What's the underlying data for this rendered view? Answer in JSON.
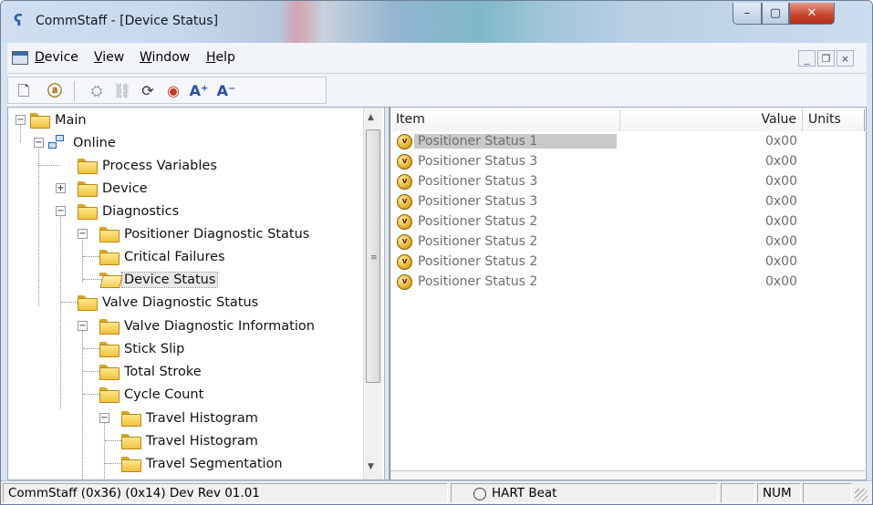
{
  "window": {
    "title": "CommStaff - [Device Status]",
    "controls": {
      "minimize": "–",
      "maximize": "▢",
      "close": "✕"
    }
  },
  "menubar": {
    "items": [
      "Device",
      "View",
      "Window",
      "Help"
    ],
    "mdi_controls": {
      "minimize": "_",
      "restore": "❐",
      "close": "×"
    }
  },
  "toolbar": {
    "icons": [
      "new-document-icon",
      "help-icon",
      "device-read-icon",
      "network-icon",
      "refresh-icon",
      "status-icon",
      "font-increase-icon",
      "font-decrease-icon"
    ]
  },
  "tree": {
    "items": [
      {
        "label": "Main",
        "level": 0,
        "expander": "minus",
        "icon": "folder"
      },
      {
        "label": "Online",
        "level": 1,
        "expander": "minus",
        "icon": "network"
      },
      {
        "label": "Process Variables",
        "level": 2,
        "expander": "",
        "icon": "folder"
      },
      {
        "label": "Device",
        "level": 2,
        "expander": "plus",
        "icon": "folder"
      },
      {
        "label": "Diagnostics",
        "level": 2,
        "expander": "minus",
        "icon": "folder"
      },
      {
        "label": "Positioner Diagnostic Status",
        "level": 3,
        "expander": "minus",
        "icon": "folder"
      },
      {
        "label": "Critical Failures",
        "level": 4,
        "expander": "",
        "icon": "folder"
      },
      {
        "label": "Device Status",
        "level": 4,
        "expander": "",
        "icon": "folder-open",
        "selected": true
      },
      {
        "label": "Valve Diagnostic Status",
        "level": 3,
        "expander": "",
        "icon": "folder"
      },
      {
        "label": "Valve Diagnostic Information",
        "level": 3,
        "expander": "minus",
        "icon": "folder"
      },
      {
        "label": "Stick Slip",
        "level": 4,
        "expander": "",
        "icon": "folder"
      },
      {
        "label": "Total Stroke",
        "level": 4,
        "expander": "",
        "icon": "folder"
      },
      {
        "label": "Cycle Count",
        "level": 4,
        "expander": "",
        "icon": "folder"
      },
      {
        "label": "Travel Histogram",
        "level": 4,
        "expander": "minus",
        "icon": "folder"
      },
      {
        "label": "Travel Histogram",
        "level": 5,
        "expander": "",
        "icon": "folder"
      },
      {
        "label": "Travel Segmentation",
        "level": 5,
        "expander": "",
        "icon": "folder"
      }
    ],
    "scroll_grip": "≡"
  },
  "list": {
    "columns": {
      "item": "Item",
      "value": "Value",
      "units": "Units"
    },
    "rows": [
      {
        "item": "Positioner Status 1",
        "value": "0x00",
        "units": "",
        "selected": true
      },
      {
        "item": "Positioner Status 3",
        "value": "0x00",
        "units": ""
      },
      {
        "item": "Positioner Status 3",
        "value": "0x00",
        "units": ""
      },
      {
        "item": "Positioner Status 3",
        "value": "0x00",
        "units": ""
      },
      {
        "item": "Positioner Status 2",
        "value": "0x00",
        "units": ""
      },
      {
        "item": "Positioner Status 2",
        "value": "0x00",
        "units": ""
      },
      {
        "item": "Positioner Status 2",
        "value": "0x00",
        "units": ""
      },
      {
        "item": "Positioner Status 2",
        "value": "0x00",
        "units": ""
      }
    ],
    "row_icon_glyph": "v"
  },
  "statusbar": {
    "info": "CommStaff  (0x36)  (0x14) Dev Rev 01.01",
    "heartbeat": "HART Beat",
    "blank": "",
    "num": "NUM",
    "end": ""
  }
}
